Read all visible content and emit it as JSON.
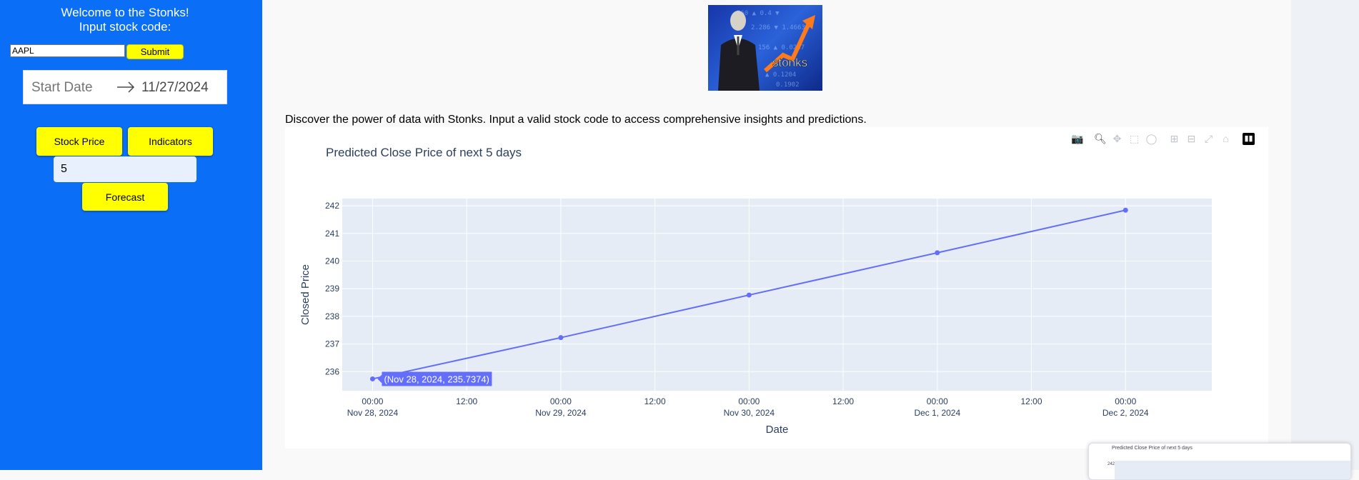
{
  "sidebar": {
    "welcome_line1": "Welcome to the Stonks!",
    "welcome_line2": "Input stock code:",
    "stock_code_value": "AAPL",
    "submit_label": "Submit",
    "date_start_placeholder": "Start Date",
    "date_end_value": "11/27/2024",
    "stock_price_label": "Stock Price",
    "indicators_label": "Indicators",
    "forecast_days_value": "5",
    "forecast_label": "Forecast"
  },
  "main": {
    "logo_text": "stonks",
    "description": "Discover the power of data with Stonks. Input a valid stock code to access comprehensive insights and predictions."
  },
  "toolbar": {
    "icons": [
      "camera-icon",
      "zoom-icon",
      "pan-icon",
      "box-select-icon",
      "lasso-select-icon",
      "zoom-in-icon",
      "zoom-out-icon",
      "autoscale-icon",
      "reset-axes-icon",
      "plotly-logo-icon"
    ]
  },
  "colors": {
    "sidebar_bg": "#0a6ef6",
    "button_yellow": "#ffff00",
    "line": "#636efa",
    "plot_bg": "#e5ecf6"
  },
  "chart_data": {
    "type": "line",
    "title": "Predicted Close Price of next 5 days",
    "xlabel": "Date",
    "ylabel": "Closed Price",
    "x": [
      "2024-11-28",
      "2024-11-29",
      "2024-11-30",
      "2024-12-01",
      "2024-12-02"
    ],
    "values": [
      235.7374,
      237.23,
      238.77,
      240.3,
      241.84
    ],
    "xlim": [
      "2024-11-27T20:08",
      "2024-12-02T11:00"
    ],
    "ylim": [
      235.31,
      242.26
    ],
    "yticks": [
      "236",
      "237",
      "238",
      "239",
      "240",
      "241",
      "242"
    ],
    "xticks": [
      {
        "time": "00:00",
        "date": "Nov 28, 2024"
      },
      {
        "time": "12:00",
        "date": ""
      },
      {
        "time": "00:00",
        "date": "Nov 29, 2024"
      },
      {
        "time": "12:00",
        "date": ""
      },
      {
        "time": "00:00",
        "date": "Nov 30, 2024"
      },
      {
        "time": "12:00",
        "date": ""
      },
      {
        "time": "00:00",
        "date": "Dec 1, 2024"
      },
      {
        "time": "12:00",
        "date": ""
      },
      {
        "time": "00:00",
        "date": "Dec 2, 2024"
      }
    ],
    "hover_label": "(Nov 28, 2024, 235.7374)",
    "grid": true
  },
  "thumbnail": {
    "title": "Predicted Close Price of next 5 days",
    "tick": "242"
  }
}
